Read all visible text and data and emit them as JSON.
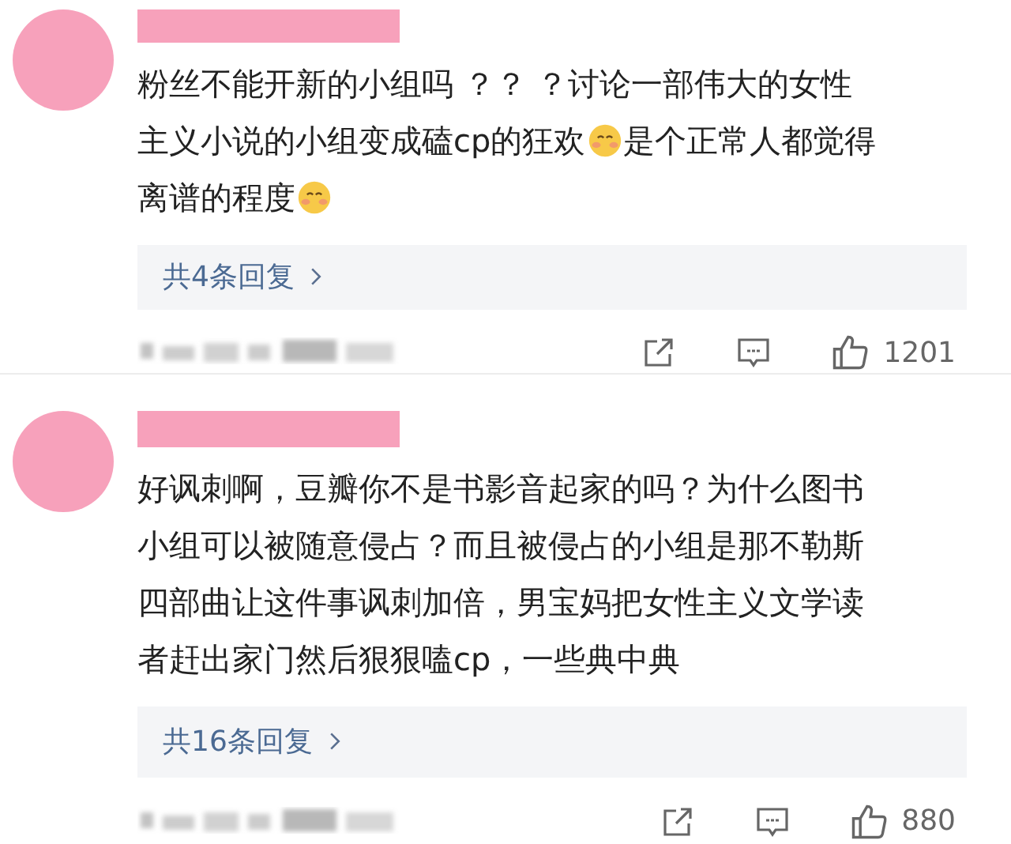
{
  "comments": [
    {
      "lines": [
        [
          {
            "kind": "text",
            "text": "粉丝不能开新的小组吗 ？？ ？讨论一部伟大的女性"
          }
        ],
        [
          {
            "kind": "text",
            "text": "主义小说的小组变成磕cp的狂欢"
          },
          {
            "kind": "emoji"
          },
          {
            "kind": "text",
            "text": "是个正常人都觉得"
          }
        ],
        [
          {
            "kind": "text",
            "text": "离谱的程度"
          },
          {
            "kind": "emoji"
          }
        ]
      ],
      "replies": "共4条回复",
      "likes": "1201"
    },
    {
      "lines": [
        [
          {
            "kind": "text",
            "text": "好讽刺啊，豆瓣你不是书影音起家的吗？为什么图书"
          }
        ],
        [
          {
            "kind": "text",
            "text": "小组可以被随意侵占？而且被侵占的小组是那不勒斯"
          }
        ],
        [
          {
            "kind": "text",
            "text": "四部曲让这件事讽刺加倍，男宝妈把女性主义文学读"
          }
        ],
        [
          {
            "kind": "text",
            "text": "者赶出家门然后狠狠嗑cp，一些典中典"
          }
        ]
      ],
      "replies": "共16条回复",
      "likes": "880"
    }
  ]
}
